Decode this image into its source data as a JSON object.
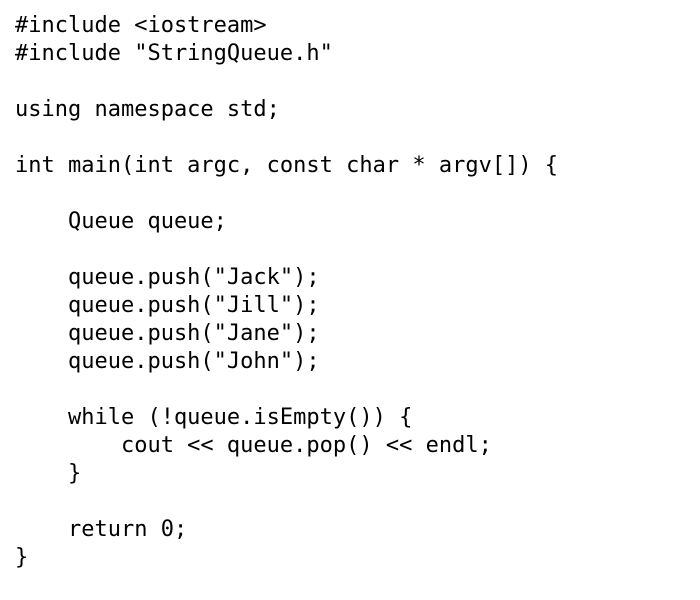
{
  "document": {
    "kind": "source-code-listing",
    "language": "C++",
    "background_color": "#ffffff",
    "text_color": "#000000",
    "font_size_px": 22,
    "line_height_px": 28,
    "indent_spaces": 4,
    "line_count": 20
  },
  "code": {
    "lines": [
      "#include <iostream>",
      "#include \"StringQueue.h\"",
      "",
      "using namespace std;",
      "",
      "int main(int argc, const char * argv[]) {",
      "",
      "    Queue queue;",
      "",
      "    queue.push(\"Jack\");",
      "    queue.push(\"Jill\");",
      "    queue.push(\"Jane\");",
      "    queue.push(\"John\");",
      "",
      "    while (!queue.isEmpty()) {",
      "        cout << queue.pop() << endl;",
      "    }",
      "",
      "    return 0;",
      "}"
    ]
  }
}
